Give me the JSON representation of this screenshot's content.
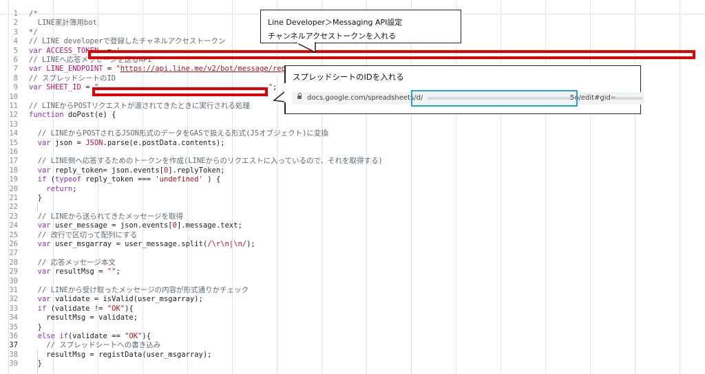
{
  "callouts": {
    "token": {
      "line1": "Line Developer＞Messaging API設定",
      "line2": "チャンネルアクセストークンを入れる"
    },
    "sheet": {
      "text": "スプレッドシートのIDを入れる"
    }
  },
  "browser": {
    "url_start": "docs.google.com/spreadsheets/d/",
    "url_end": "5o/edit#gid="
  },
  "colors": {
    "highlight_red": "#e00000",
    "highlight_blue": "#1fa2e0"
  },
  "code_lines": [
    {
      "n": "1",
      "t": [
        [
          "cm",
          "/*"
        ]
      ]
    },
    {
      "n": "2",
      "t": [
        [
          "cm",
          "  LINE家計簿用bot"
        ]
      ]
    },
    {
      "n": "3",
      "t": [
        [
          "cm",
          "*/"
        ]
      ]
    },
    {
      "n": "4",
      "t": [
        [
          "cm",
          "// LINE developerで登録したチャネルアクセストークン"
        ]
      ]
    },
    {
      "n": "5",
      "t": [
        [
          "kw",
          "var "
        ],
        [
          "cn",
          "ACCESS_TOKEN"
        ],
        [
          "",
          "  = "
        ],
        [
          "str",
          "'"
        ]
      ]
    },
    {
      "n": "6",
      "t": [
        [
          "cm",
          "// LINEへ応答メッセージを送るAPI"
        ]
      ]
    },
    {
      "n": "7",
      "t": [
        [
          "kw",
          "var "
        ],
        [
          "cn",
          "LINE_ENDPOINT"
        ],
        [
          "",
          " = "
        ],
        [
          "str",
          "\""
        ],
        [
          "url",
          "https://api.line.me/v2/bot/message/reply"
        ],
        [
          "str",
          "\""
        ],
        [
          "",
          ";"
        ]
      ]
    },
    {
      "n": "8",
      "t": [
        [
          "cm",
          "// スプレッドシートのID"
        ]
      ]
    },
    {
      "n": "9",
      "t": [
        [
          "kw",
          "var "
        ],
        [
          "cn",
          "SHEET_ID"
        ],
        [
          "",
          " = "
        ],
        [
          "str",
          "\""
        ],
        [
          "",
          "                                       "
        ],
        [
          "str",
          "\""
        ],
        [
          "",
          ";"
        ]
      ]
    },
    {
      "n": "10",
      "t": [
        [
          "",
          ""
        ]
      ]
    },
    {
      "n": "11",
      "t": [
        [
          "cm",
          "// LINEからPOSTリクエストが渡されてきたときに実行される処理"
        ]
      ]
    },
    {
      "n": "12",
      "t": [
        [
          "kw",
          "function "
        ],
        [
          "",
          "doPost(e) {"
        ]
      ]
    },
    {
      "n": "13",
      "t": [
        [
          "",
          ""
        ]
      ]
    },
    {
      "n": "14",
      "t": [
        [
          "cm",
          "  // LINEからPOSTされるJSON形式のデータをGASで扱える形式(JSオブジェクト)に変換"
        ]
      ]
    },
    {
      "n": "15",
      "t": [
        [
          "kw",
          "  var "
        ],
        [
          "",
          "json = "
        ],
        [
          "cn",
          "JSON"
        ],
        [
          "",
          ".parse(e.postData.contents);"
        ]
      ]
    },
    {
      "n": "16",
      "t": [
        [
          "",
          ""
        ]
      ]
    },
    {
      "n": "17",
      "t": [
        [
          "cm",
          "  // LINE側へ応答するためのトークンを作成(LINEからのリクエストに入っているので、それを取得する)"
        ]
      ]
    },
    {
      "n": "18",
      "t": [
        [
          "kw",
          "  var "
        ],
        [
          "",
          "reply_token= json.events["
        ],
        [
          "num",
          "0"
        ],
        [
          "",
          "].replyToken;"
        ]
      ]
    },
    {
      "n": "19",
      "t": [
        [
          "kw",
          "  if "
        ],
        [
          "",
          "("
        ],
        [
          "kw",
          "typeof "
        ],
        [
          "",
          "reply_token === "
        ],
        [
          "str",
          "'undefined'"
        ],
        [
          "",
          " ) {"
        ]
      ]
    },
    {
      "n": "20",
      "t": [
        [
          "kw",
          "    return"
        ],
        [
          "",
          ";"
        ]
      ]
    },
    {
      "n": "21",
      "t": [
        [
          "",
          "  }"
        ]
      ]
    },
    {
      "n": "22",
      "t": [
        [
          "",
          ""
        ]
      ]
    },
    {
      "n": "23",
      "t": [
        [
          "cm",
          "  // LINEから送られてきたメッセージを取得"
        ]
      ]
    },
    {
      "n": "24",
      "t": [
        [
          "kw",
          "  var "
        ],
        [
          "",
          "user_message = json.events["
        ],
        [
          "num",
          "0"
        ],
        [
          "",
          "].message.text;"
        ]
      ]
    },
    {
      "n": "25",
      "t": [
        [
          "cm",
          "  // 改行で区切って配列にする"
        ]
      ]
    },
    {
      "n": "26",
      "t": [
        [
          "kw",
          "  var "
        ],
        [
          "",
          "user_msgarray = user_message.split("
        ],
        [
          "str",
          "/\\r\\n|\\n/"
        ],
        [
          "",
          ");"
        ]
      ]
    },
    {
      "n": "27",
      "t": [
        [
          "",
          ""
        ]
      ]
    },
    {
      "n": "28",
      "t": [
        [
          "cm",
          "  // 応答メッセージ本文"
        ]
      ]
    },
    {
      "n": "29",
      "t": [
        [
          "kw",
          "  var "
        ],
        [
          "",
          "resultMsg = "
        ],
        [
          "str",
          "\"\""
        ],
        [
          "",
          ";"
        ]
      ]
    },
    {
      "n": "30",
      "t": [
        [
          "",
          ""
        ]
      ]
    },
    {
      "n": "31",
      "t": [
        [
          "cm",
          "  // LINEから受け取ったメッセージの内容が形式通りかチェック"
        ]
      ]
    },
    {
      "n": "32",
      "t": [
        [
          "kw",
          "  var "
        ],
        [
          "",
          "validate = isValid(user_msgarray);"
        ]
      ]
    },
    {
      "n": "33",
      "t": [
        [
          "kw",
          "  if "
        ],
        [
          "",
          "(validate != "
        ],
        [
          "str",
          "\"OK\""
        ],
        [
          "",
          "){"
        ]
      ]
    },
    {
      "n": "34",
      "t": [
        [
          "",
          "    resultMsg = validate;"
        ]
      ]
    },
    {
      "n": "35",
      "t": [
        [
          "",
          "  }"
        ]
      ]
    },
    {
      "n": "36",
      "t": [
        [
          "kw",
          "  else if"
        ],
        [
          "",
          "(validate == "
        ],
        [
          "str",
          "\"OK\""
        ],
        [
          "",
          "){"
        ]
      ]
    },
    {
      "n": "37",
      "t": [
        [
          "cm",
          "    // スプレッドシートへの書き込み"
        ]
      ]
    },
    {
      "n": "38",
      "t": [
        [
          "",
          "    resultMsg = registData(user_msgarray);"
        ]
      ]
    },
    {
      "n": "39",
      "t": [
        [
          "",
          "  }"
        ]
      ]
    }
  ]
}
